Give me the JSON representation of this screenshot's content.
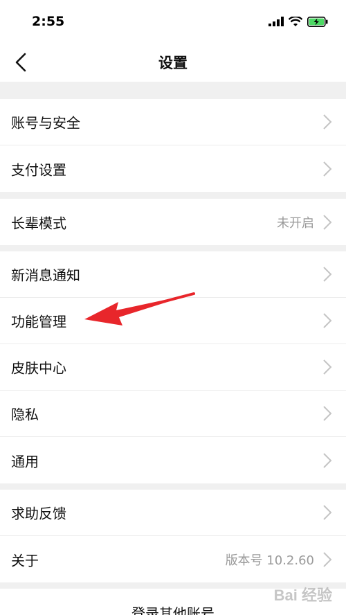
{
  "status_bar": {
    "time": "2:55"
  },
  "nav": {
    "title": "设置"
  },
  "groups": [
    {
      "items": [
        {
          "label": "账号与安全",
          "value": ""
        },
        {
          "label": "支付设置",
          "value": ""
        }
      ]
    },
    {
      "items": [
        {
          "label": "长辈模式",
          "value": "未开启"
        }
      ]
    },
    {
      "items": [
        {
          "label": "新消息通知",
          "value": ""
        },
        {
          "label": "功能管理",
          "value": ""
        },
        {
          "label": "皮肤中心",
          "value": ""
        },
        {
          "label": "隐私",
          "value": ""
        },
        {
          "label": "通用",
          "value": ""
        }
      ]
    },
    {
      "items": [
        {
          "label": "求助反馈",
          "value": ""
        },
        {
          "label": "关于",
          "value": "版本号 10.2.60"
        }
      ]
    }
  ],
  "bottom_link": "登录其他账号",
  "watermark": "Bai 经验",
  "colors": {
    "background": "#f0f0f0",
    "annotation_arrow": "#e8262b",
    "battery": "#4cd964"
  },
  "icons": [
    "back-icon",
    "chevron-right-icon",
    "signal-icon",
    "wifi-icon",
    "battery-charging-icon"
  ]
}
